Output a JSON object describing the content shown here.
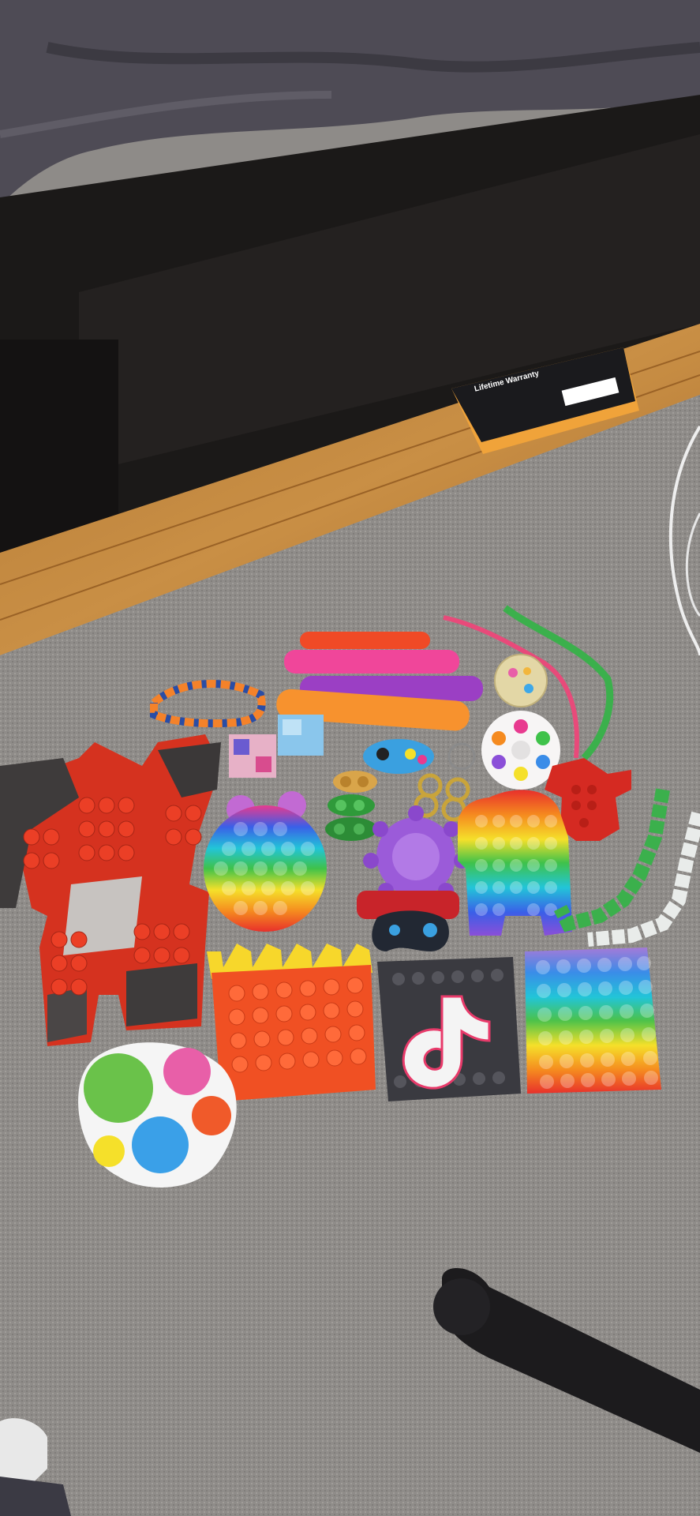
{
  "warranty_card": {
    "title": "Lifetime Warranty"
  }
}
